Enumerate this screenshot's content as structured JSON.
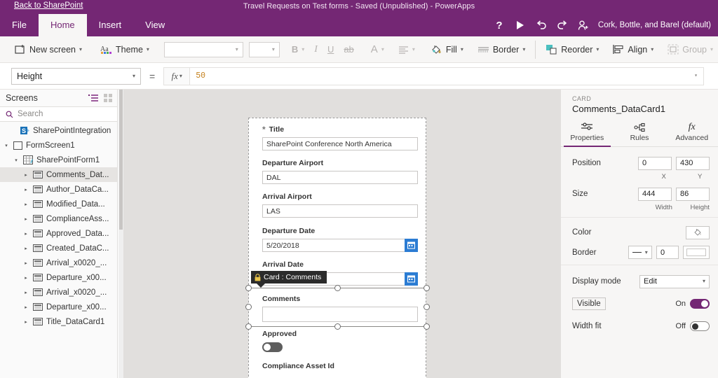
{
  "titlebar": {
    "back_link": "Back to SharePoint",
    "window_title": "Travel Requests on Test forms - Saved (Unpublished) - PowerApps"
  },
  "menubar": {
    "items": [
      {
        "label": "File",
        "active": false
      },
      {
        "label": "Home",
        "active": true
      },
      {
        "label": "Insert",
        "active": false
      },
      {
        "label": "View",
        "active": false
      }
    ],
    "help_icon": "question-mark-icon",
    "play_icon": "play-icon",
    "undo_icon": "undo-icon",
    "redo_icon": "redo-icon",
    "share_icon": "add-user-icon",
    "account": "Cork, Bottle, and Barel (default)"
  },
  "ribbon": {
    "new_screen": "New screen",
    "theme": "Theme",
    "font_family_value": "",
    "font_size_value": "",
    "bold": "B",
    "italic": "I",
    "underline": "U",
    "strikethrough": "ab",
    "font_color": "A",
    "align": "align-icon",
    "fill": "Fill",
    "border": "Border",
    "reorder": "Reorder",
    "align_label": "Align",
    "group": "Group"
  },
  "formulabar": {
    "property": "Height",
    "equals": "=",
    "fx": "fx",
    "formula": "50"
  },
  "left_panel": {
    "title": "Screens",
    "tree_view_icon": "tree-view-icon",
    "thumbnail_view_icon": "grid-view-icon",
    "search_placeholder": "Search",
    "search_icon": "search-icon",
    "tree": [
      {
        "label": "SharePointIntegration",
        "indent": 1,
        "icon": "sharepoint-icon",
        "twisty": "",
        "selected": false
      },
      {
        "label": "FormScreen1",
        "indent": 0,
        "icon": "screen-icon",
        "twisty": "▾",
        "selected": false
      },
      {
        "label": "SharePointForm1",
        "indent": 1,
        "icon": "form-icon",
        "twisty": "▾",
        "selected": false
      },
      {
        "label": "Comments_Dat...",
        "indent": 2,
        "icon": "card-icon",
        "twisty": "▸",
        "selected": true
      },
      {
        "label": "Author_DataCa...",
        "indent": 2,
        "icon": "card-icon",
        "twisty": "▸",
        "selected": false
      },
      {
        "label": "Modified_Data...",
        "indent": 2,
        "icon": "card-icon",
        "twisty": "▸",
        "selected": false
      },
      {
        "label": "ComplianceAss...",
        "indent": 2,
        "icon": "card-icon",
        "twisty": "▸",
        "selected": false
      },
      {
        "label": "Approved_Data...",
        "indent": 2,
        "icon": "card-icon",
        "twisty": "▸",
        "selected": false
      },
      {
        "label": "Created_DataC...",
        "indent": 2,
        "icon": "card-icon",
        "twisty": "▸",
        "selected": false
      },
      {
        "label": "Arrival_x0020_...",
        "indent": 2,
        "icon": "card-icon",
        "twisty": "▸",
        "selected": false
      },
      {
        "label": "Departure_x00...",
        "indent": 2,
        "icon": "card-icon",
        "twisty": "▸",
        "selected": false
      },
      {
        "label": "Arrival_x0020_...",
        "indent": 2,
        "icon": "card-icon",
        "twisty": "▸",
        "selected": false
      },
      {
        "label": "Departure_x00...",
        "indent": 2,
        "icon": "card-icon",
        "twisty": "▸",
        "selected": false
      },
      {
        "label": "Title_DataCard1",
        "indent": 2,
        "icon": "card-icon",
        "twisty": "▸",
        "selected": false
      }
    ]
  },
  "canvas": {
    "fields": [
      {
        "label": "Title",
        "required": true,
        "value": "SharePoint Conference North America",
        "type": "text"
      },
      {
        "label": "Departure Airport",
        "required": false,
        "value": "DAL",
        "type": "text"
      },
      {
        "label": "Arrival Airport",
        "required": false,
        "value": "LAS",
        "type": "text"
      },
      {
        "label": "Departure Date",
        "required": false,
        "value": "5/20/2018",
        "type": "date"
      },
      {
        "label": "Arrival Date",
        "required": false,
        "value": "",
        "type": "date"
      },
      {
        "label": "Comments",
        "required": false,
        "value": "",
        "type": "text"
      },
      {
        "label": "Approved",
        "required": false,
        "value": "Off",
        "type": "toggle"
      },
      {
        "label": "Compliance Asset Id",
        "required": false,
        "value": "",
        "type": "text"
      }
    ],
    "tooltip": "Card : Comments",
    "tooltip_icon": "lock-icon"
  },
  "right_panel": {
    "kind": "CARD",
    "name": "Comments_DataCard1",
    "tabs": [
      {
        "label": "Properties",
        "icon": "sliders-icon",
        "active": true
      },
      {
        "label": "Rules",
        "icon": "rules-icon",
        "active": false
      },
      {
        "label": "Advanced",
        "icon": "fx-icon",
        "active": false
      }
    ],
    "position": {
      "label": "Position",
      "x": "0",
      "y": "430",
      "x_sub": "X",
      "y_sub": "Y"
    },
    "size": {
      "label": "Size",
      "width": "444",
      "height": "86",
      "width_sub": "Width",
      "height_sub": "Height"
    },
    "color": {
      "label": "Color",
      "icon": "fill-bucket-icon"
    },
    "border": {
      "label": "Border",
      "style": "solid",
      "thickness": "0",
      "color_swatch": "#ffffff"
    },
    "display_mode": {
      "label": "Display mode",
      "value": "Edit"
    },
    "visible": {
      "label": "Visible",
      "state": "On"
    },
    "width_fit": {
      "label": "Width fit",
      "state": "Off"
    }
  },
  "colors": {
    "brand_purple": "#742774",
    "canvas_gray": "#e1dfdd",
    "panel_gray": "#f7f6f5",
    "date_button_blue": "#2b7cd3",
    "formula_orange": "#c47f1a",
    "tooltip_bg": "#2b2b2b",
    "lock_yellow": "#e8c34a"
  }
}
